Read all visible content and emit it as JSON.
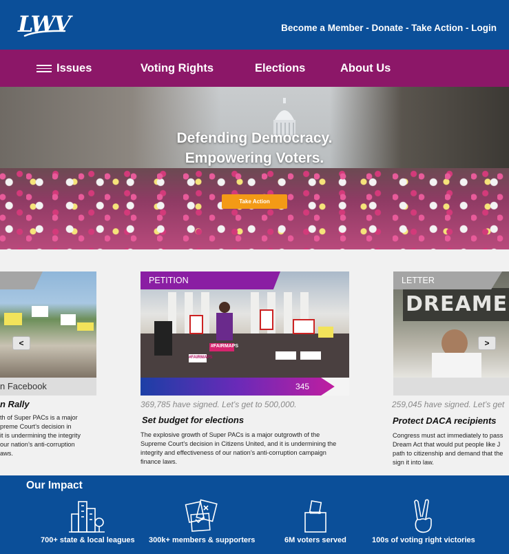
{
  "header": {
    "logo_text": "LWV",
    "links": [
      "Become a Member",
      "Donate",
      "Take Action",
      "Login"
    ],
    "separator": " - "
  },
  "nav": {
    "items": [
      "Issues",
      "Voting Rights",
      "Elections",
      "About Us"
    ]
  },
  "hero": {
    "line1": "Defending Democracy.",
    "line2": "Empowering Voters.",
    "button": "Take Action"
  },
  "cards": {
    "left": {
      "caption": "n Facebook",
      "title": "n Rally",
      "body": [
        "th of Super PACs is a major",
        "preme Court’s decision in",
        "it is undermining the integrity",
        "our nation’s anti-corruption",
        "aws."
      ]
    },
    "center": {
      "tag": "PETITION",
      "progress_value": "345",
      "progress_fraction": 0.93,
      "caption": "369,785 have signed. Let’s get to 500,000.",
      "title": "Set budget for elections",
      "body": "The explosive growth of Super PACs is a major outgrowth of the Supreme Court’s decision in Citizens United, and it is undermining the integrity and effectiveness of our nation’s anti-corruption campaign finance laws.",
      "photo_signs": [
        "#FAIRMAPS",
        "#FAIRMAPS"
      ]
    },
    "right": {
      "tag": "LETTER",
      "sign_text": "DREAMER",
      "caption": "259,045 have signed. Let’s get",
      "title": "Protect DACA recipients",
      "body": [
        "Congress must act immediately to pass",
        "Dream Act that would put people like J",
        "path to citizenship and demand that the",
        "sign it into law."
      ]
    },
    "prev_label": "<",
    "next_label": ">"
  },
  "impact": {
    "title": "Our Impact",
    "items": [
      {
        "label": "700+ state & local leagues",
        "icon": "city-buildings-icon"
      },
      {
        "label": "300k+ members & supporters",
        "icon": "ballots-icon"
      },
      {
        "label": "6M voters served",
        "icon": "ballot-box-icon"
      },
      {
        "label": "100s of voting right victories",
        "icon": "peace-hand-icon"
      }
    ]
  },
  "colors": {
    "header_blue": "#0b4f99",
    "nav_purple": "#8c1768",
    "cta_orange": "#f39a16",
    "tag_purple": "#8a1ea3",
    "tag_gray": "#a5a5a5"
  }
}
